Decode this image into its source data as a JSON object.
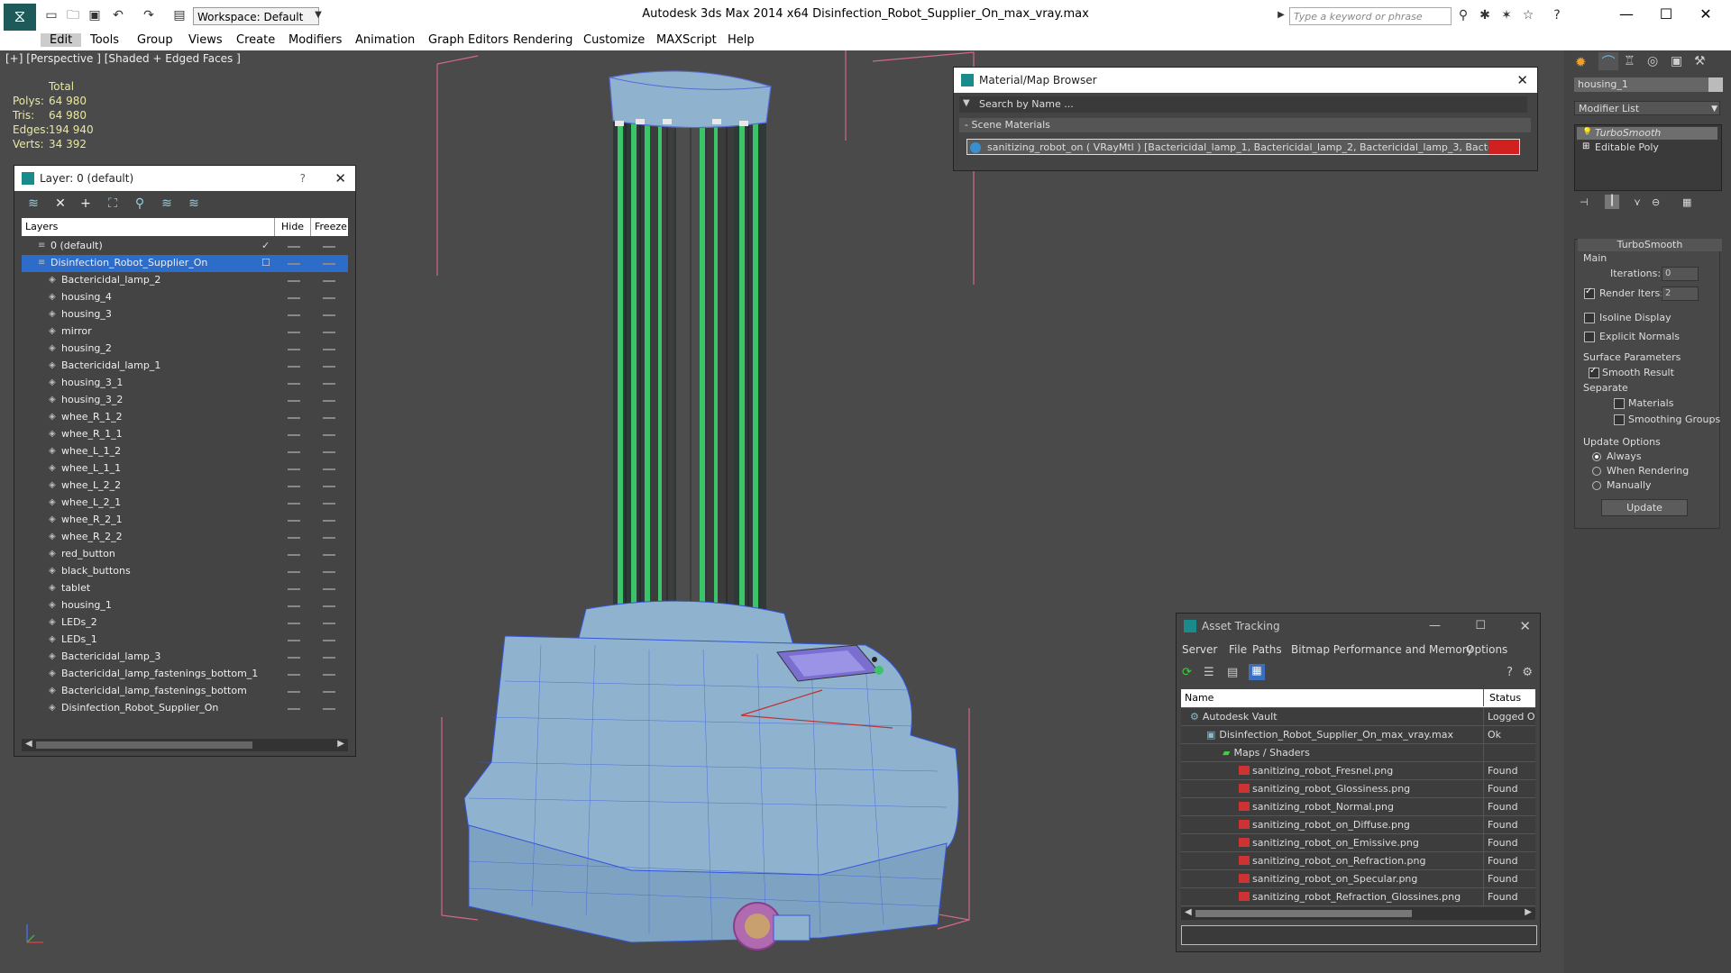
{
  "window": {
    "title": "Autodesk 3ds Max  2014 x64       Disinfection_Robot_Supplier_On_max_vray.max",
    "workspace": "Workspace: Default",
    "search_placeholder": "Type a keyword or phrase"
  },
  "menu": [
    "Edit",
    "Tools",
    "Group",
    "Views",
    "Create",
    "Modifiers",
    "Animation",
    "Graph Editors",
    "Rendering",
    "Customize",
    "MAXScript",
    "Help"
  ],
  "viewport": {
    "label": "[+] [Perspective ] [Shaded + Edged Faces ]",
    "stats": {
      "header": "Total",
      "rows": [
        {
          "label": "Polys:",
          "value": "64 980"
        },
        {
          "label": "Tris:",
          "value": "64 980"
        },
        {
          "label": "Edges:",
          "value": "194 940"
        },
        {
          "label": "Verts:",
          "value": "34 392"
        }
      ]
    }
  },
  "layers_panel": {
    "title": "Layer: 0 (default)",
    "help": "?",
    "col_layers": "Layers",
    "col_hide": "Hide",
    "col_freeze": "Freeze",
    "rows": [
      {
        "name": "0 (default)",
        "level": 0
      },
      {
        "name": "Disinfection_Robot_Supplier_On",
        "level": 0,
        "selected": true
      },
      {
        "name": "Bactericidal_lamp_2",
        "level": 1
      },
      {
        "name": "housing_4",
        "level": 1
      },
      {
        "name": "housing_3",
        "level": 1
      },
      {
        "name": "mirror",
        "level": 1
      },
      {
        "name": "housing_2",
        "level": 1
      },
      {
        "name": "Bactericidal_lamp_1",
        "level": 1
      },
      {
        "name": "housing_3_1",
        "level": 1
      },
      {
        "name": "housing_3_2",
        "level": 1
      },
      {
        "name": "whee_R_1_2",
        "level": 1
      },
      {
        "name": "whee_R_1_1",
        "level": 1
      },
      {
        "name": "whee_L_1_2",
        "level": 1
      },
      {
        "name": "whee_L_1_1",
        "level": 1
      },
      {
        "name": "whee_L_2_2",
        "level": 1
      },
      {
        "name": "whee_L_2_1",
        "level": 1
      },
      {
        "name": "whee_R_2_1",
        "level": 1
      },
      {
        "name": "whee_R_2_2",
        "level": 1
      },
      {
        "name": "red_button",
        "level": 1
      },
      {
        "name": "black_buttons",
        "level": 1
      },
      {
        "name": "tablet",
        "level": 1
      },
      {
        "name": "housing_1",
        "level": 1
      },
      {
        "name": "LEDs_2",
        "level": 1
      },
      {
        "name": "LEDs_1",
        "level": 1
      },
      {
        "name": "Bactericidal_lamp_3",
        "level": 1
      },
      {
        "name": "Bactericidal_lamp_fastenings_bottom_1",
        "level": 1
      },
      {
        "name": "Bactericidal_lamp_fastenings_bottom",
        "level": 1
      },
      {
        "name": "Disinfection_Robot_Supplier_On",
        "level": 1
      }
    ]
  },
  "material_browser": {
    "title": "Material/Map Browser",
    "search_placeholder": "Search by Name ...",
    "section": "- Scene Materials",
    "item": "sanitizing_robot_on ( VRayMtl ) [Bactericidal_lamp_1, Bactericidal_lamp_2, Bactericidal_lamp_3, Bactericidal_lamp..."
  },
  "command_panel": {
    "object_name": "housing_1",
    "modifier_list": "Modifier List",
    "stack": [
      "TurboSmooth",
      "Editable Poly"
    ],
    "rollout_title": "TurboSmooth",
    "main_label": "Main",
    "iterations_label": "Iterations:",
    "iterations_value": "0",
    "render_iters_label": "Render Iters:",
    "render_iters_value": "2",
    "isoline_label": "Isoline Display",
    "explicit_normals_label": "Explicit Normals",
    "surface_params_label": "Surface Parameters",
    "smooth_result_label": "Smooth Result",
    "separate_label": "Separate",
    "materials_label": "Materials",
    "smoothing_groups_label": "Smoothing Groups",
    "update_options_label": "Update Options",
    "always_label": "Always",
    "when_rendering_label": "When Rendering",
    "manually_label": "Manually",
    "update_button": "Update"
  },
  "asset_tracking": {
    "title": "Asset Tracking",
    "menu": [
      "Server",
      "File",
      "Paths",
      "Bitmap Performance and Memory",
      "Options"
    ],
    "col_name": "Name",
    "col_status": "Status",
    "rows": [
      {
        "name": "Autodesk Vault",
        "status": "Logged O",
        "indent": 1,
        "type": "vault"
      },
      {
        "name": "Disinfection_Robot_Supplier_On_max_vray.max",
        "status": "Ok",
        "indent": 2,
        "type": "max"
      },
      {
        "name": "Maps / Shaders",
        "status": "",
        "indent": 3,
        "type": "folder"
      },
      {
        "name": "sanitizing_robot_Fresnel.png",
        "status": "Found",
        "indent": 4,
        "type": "png"
      },
      {
        "name": "sanitizing_robot_Glossiness.png",
        "status": "Found",
        "indent": 4,
        "type": "png"
      },
      {
        "name": "sanitizing_robot_Normal.png",
        "status": "Found",
        "indent": 4,
        "type": "png"
      },
      {
        "name": "sanitizing_robot_on_Diffuse.png",
        "status": "Found",
        "indent": 4,
        "type": "png"
      },
      {
        "name": "sanitizing_robot_on_Emissive.png",
        "status": "Found",
        "indent": 4,
        "type": "png"
      },
      {
        "name": "sanitizing_robot_on_Refraction.png",
        "status": "Found",
        "indent": 4,
        "type": "png"
      },
      {
        "name": "sanitizing_robot_on_Specular.png",
        "status": "Found",
        "indent": 4,
        "type": "png"
      },
      {
        "name": "sanitizing_robot_Refraction_Glossines.png",
        "status": "Found",
        "indent": 4,
        "type": "png"
      }
    ]
  },
  "colors": {
    "selection": "#2e6cc9",
    "viewport_bg": "#4a4a4a",
    "stats_text": "#e8e8a0",
    "mesh_fill": "#8fb3cf",
    "lamp_green": "#3cc46a"
  }
}
